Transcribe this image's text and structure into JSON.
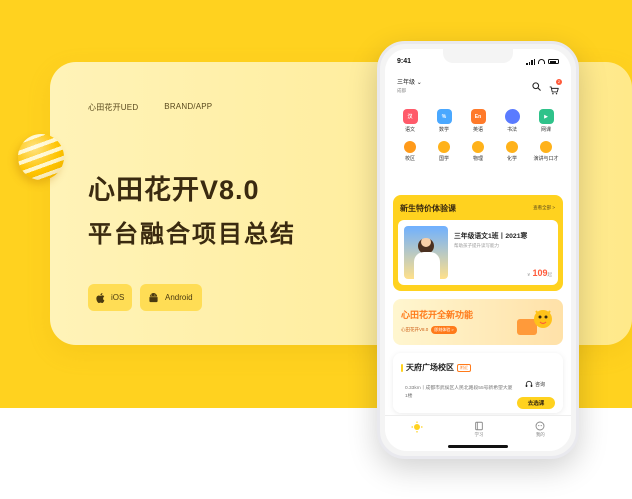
{
  "hero": {
    "brand": "心田花开UED",
    "category": "BRAND/APP",
    "title": "心田花开V8.0",
    "subtitle": "平台融合项目总结",
    "platforms": [
      {
        "label": "iOS",
        "icon": "apple-icon"
      },
      {
        "label": "Android",
        "icon": "android-icon"
      }
    ]
  },
  "phone": {
    "status": {
      "time": "9:41"
    },
    "header": {
      "grade": "三年级",
      "city": "成都",
      "cart_count": "2"
    },
    "subjects": [
      {
        "label": "语文",
        "glyph": "汉",
        "color": "#ff5a6a",
        "icon": "chinese-icon"
      },
      {
        "label": "数学",
        "glyph": "%",
        "color": "#4aa8ff",
        "icon": "math-icon"
      },
      {
        "label": "英语",
        "glyph": "En",
        "color": "#ff7a2a",
        "icon": "english-icon"
      },
      {
        "label": "书法",
        "glyph": "",
        "color": "#5a7bff",
        "icon": "calligraphy-icon"
      },
      {
        "label": "网课",
        "glyph": "",
        "color": "#2fc28a",
        "icon": "online-class-icon"
      },
      {
        "label": "校区",
        "glyph": "",
        "color": "#ff9a1a",
        "icon": "campus-icon"
      },
      {
        "label": "国学",
        "glyph": "",
        "color": "#ffb21a",
        "icon": "sinology-icon"
      },
      {
        "label": "物理",
        "glyph": "",
        "color": "#ffb21a",
        "icon": "physics-icon"
      },
      {
        "label": "化学",
        "glyph": "",
        "color": "#ffb21a",
        "icon": "chemistry-icon"
      },
      {
        "label": "演讲与口才",
        "glyph": "",
        "color": "#ffb21a",
        "icon": "speech-icon"
      }
    ],
    "new_course": {
      "heading": "新生特价体验课",
      "more": "查看全部 >",
      "course_title": "三年级语文1班丨2021寒",
      "course_desc": "帮助孩子提升读写能力",
      "price_symbol": "¥",
      "price": "109",
      "price_unit": "起"
    },
    "promo": {
      "title": "心田花开全新功能",
      "version": "心田花开V8.0",
      "pill": "即刻体验 >"
    },
    "campus": {
      "name": "天府广场校区",
      "tag": "附近",
      "address": "0.33km丨成都市武侯区人民北路段55号新希望大厦1楼",
      "consult": "咨询",
      "go": "去选课"
    },
    "tabs": [
      {
        "label": "",
        "icon": "home-sun-icon"
      },
      {
        "label": "学习",
        "icon": "study-book-icon"
      },
      {
        "label": "我的",
        "icon": "profile-icon"
      }
    ]
  }
}
